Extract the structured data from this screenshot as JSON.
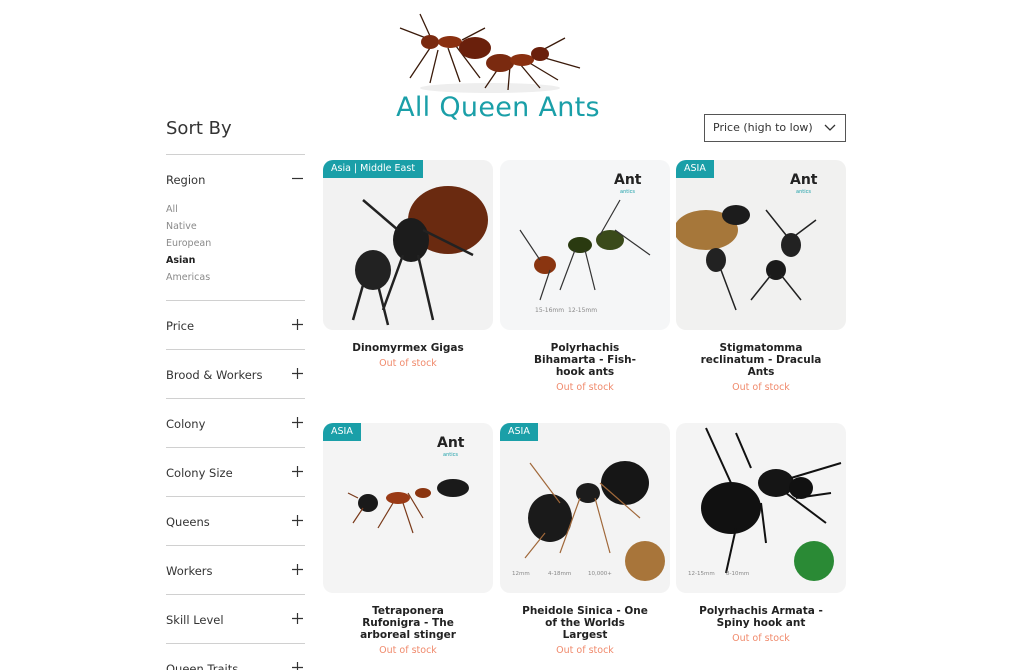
{
  "header": {
    "title": "All Queen Ants"
  },
  "sort": {
    "label": "Sort By",
    "selected": "Price (high to low)"
  },
  "filters": {
    "region": {
      "label": "Region",
      "options": [
        "All",
        "Native",
        "European",
        "Asian",
        "Americas"
      ],
      "selected": "Asian"
    },
    "price": "Price",
    "brood_workers": "Brood & Workers",
    "colony": "Colony",
    "colony_size": "Colony Size",
    "queens": "Queens",
    "workers": "Workers",
    "skill_level": "Skill Level",
    "queen_traits": "Queen Traits"
  },
  "products": [
    {
      "name": "Dinomyrmex Gigas",
      "badge": "Asia | Middle East",
      "status": "Out of stock"
    },
    {
      "name": "Polyrhachis Bihamarta - Fish-hook ants",
      "badge": "",
      "status": "Out of stock"
    },
    {
      "name": "Stigmatomma reclinatum - Dracula Ants",
      "badge": "ASIA",
      "status": "Out of stock"
    },
    {
      "name": "Tetraponera Rufonigra - The arboreal stinger",
      "badge": "ASIA",
      "status": "Out of stock"
    },
    {
      "name": "Pheidole Sinica - One of the Worlds Largest",
      "badge": "ASIA",
      "status": "Out of stock"
    },
    {
      "name": "Polyrhachis Armata - Spiny hook ant",
      "badge": "",
      "status": "Out of stock"
    }
  ],
  "logo_text": {
    "main": "Ant",
    "sub": "antics"
  },
  "colors": {
    "accent": "#1a9fa8",
    "out_of_stock": "#f08a6c"
  }
}
